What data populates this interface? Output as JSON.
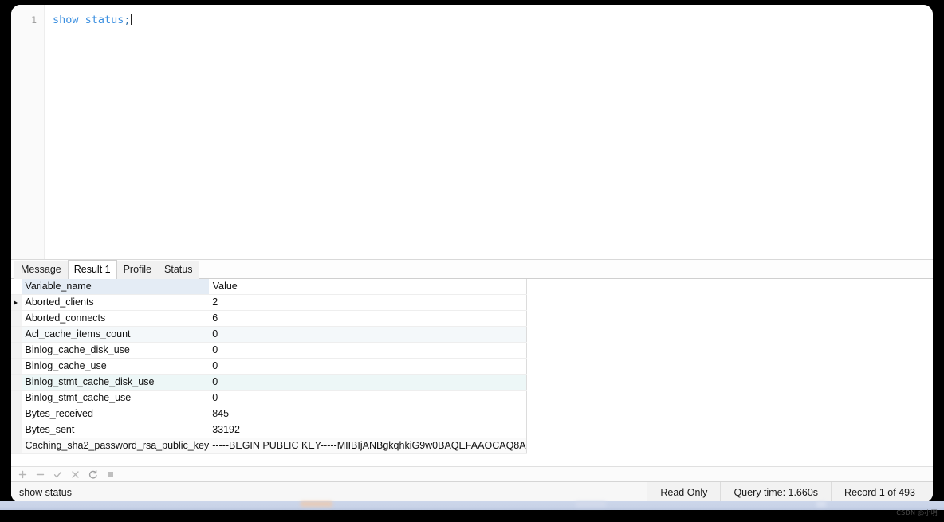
{
  "editor": {
    "line_number": "1",
    "sql_keyword_1": "show",
    "sql_keyword_2": "status",
    "sql_terminator": ";",
    "full_statement": "show status;"
  },
  "tabs": [
    {
      "label": "Message",
      "active": false
    },
    {
      "label": "Result 1",
      "active": true
    },
    {
      "label": "Profile",
      "active": false
    },
    {
      "label": "Status",
      "active": false
    }
  ],
  "grid": {
    "columns": [
      "Variable_name",
      "Value"
    ],
    "rows": [
      {
        "name": "Aborted_clients",
        "value": "2",
        "current": true
      },
      {
        "name": "Aborted_connects",
        "value": "6",
        "current": false
      },
      {
        "name": "Acl_cache_items_count",
        "value": "0",
        "current": false
      },
      {
        "name": "Binlog_cache_disk_use",
        "value": "0",
        "current": false
      },
      {
        "name": "Binlog_cache_use",
        "value": "0",
        "current": false
      },
      {
        "name": "Binlog_stmt_cache_disk_use",
        "value": "0",
        "current": false
      },
      {
        "name": "Binlog_stmt_cache_use",
        "value": "0",
        "current": false
      },
      {
        "name": "Bytes_received",
        "value": "845",
        "current": false
      },
      {
        "name": "Bytes_sent",
        "value": "33192",
        "current": false
      },
      {
        "name": "Caching_sha2_password_rsa_public_key",
        "value": "-----BEGIN PUBLIC KEY-----MIIBIjANBgkqhkiG9w0BAQEFAAOCAQ8A",
        "current": false
      }
    ]
  },
  "grid_toolbar": {
    "icons": [
      {
        "name": "add-row-icon",
        "glyph": "+"
      },
      {
        "name": "delete-row-icon",
        "glyph": "−"
      },
      {
        "name": "apply-changes-icon",
        "glyph": "✓"
      },
      {
        "name": "cancel-changes-icon",
        "glyph": "×"
      },
      {
        "name": "refresh-icon",
        "glyph": "↻"
      },
      {
        "name": "stop-icon",
        "glyph": "■"
      }
    ]
  },
  "status_bar": {
    "query": "show status",
    "read_only": "Read Only",
    "query_time": "Query time: 1.660s",
    "record": "Record 1 of 493"
  },
  "watermark": "CSDN @小明",
  "colors": {
    "keyword": "#3b8fe0",
    "header_tint": "#e4ecf5",
    "window_bg": "#ffffff",
    "desktop_bg": "#000000"
  }
}
